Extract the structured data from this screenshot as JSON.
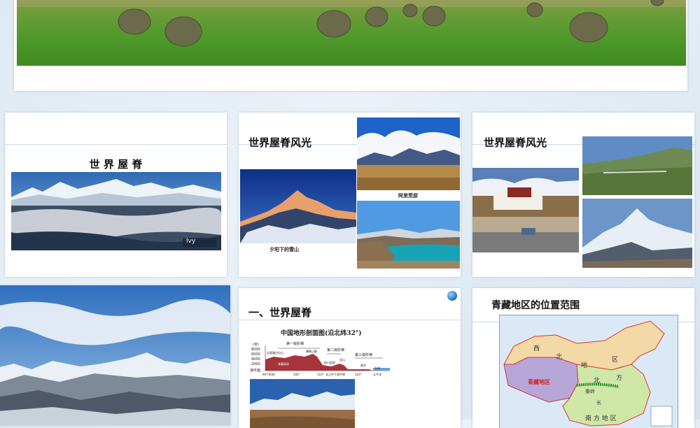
{
  "slides": {
    "s2": {
      "title": "世 界 屋 脊",
      "watermark": "lvy"
    },
    "s3": {
      "title": "世界屋脊风光",
      "caption_ali": "阿里荒原",
      "caption_sunset": "夕阳下的雪山"
    },
    "s4": {
      "title": "世界屋脊风光"
    },
    "s6": {
      "title": "一、世界屋脊",
      "profile_title": "中国地形剖面图(沿北纬32°)",
      "profile": {
        "stage1": "第一级阶梯",
        "stage2": "第二级阶梯",
        "stage3": "第三级阶梯",
        "y_unit": "(米)",
        "y_ticks": [
          "8000",
          "6000",
          "4000",
          "2000",
          "海平面"
        ],
        "labels": [
          "念青唐古拉山",
          "横断山脉",
          "青藏高原",
          "四川盆地",
          "巫山",
          "南京"
        ],
        "x_ticks": [
          "90°(东经)",
          "100°",
          "110°",
          "长江中下游平原",
          "120°",
          "东海"
        ],
        "sea_label": "太平洋"
      }
    },
    "s7": {
      "title": "青藏地区的位置范围",
      "map_labels": {
        "west": "西",
        "north": "北",
        "di": "地",
        "qu": "区",
        "qingzang": "青藏地区",
        "bei": "北",
        "fang": "方",
        "qinling": "秦岭",
        "nan_fang": "南 方 地 区",
        "chang": "长"
      }
    }
  },
  "colors": {
    "accent_rule": "#c9d9ea",
    "map_qingzang": "#b7a6d8",
    "map_north": "#f3d9a6",
    "map_south": "#cfe8a8",
    "map_border": "#e63030"
  }
}
